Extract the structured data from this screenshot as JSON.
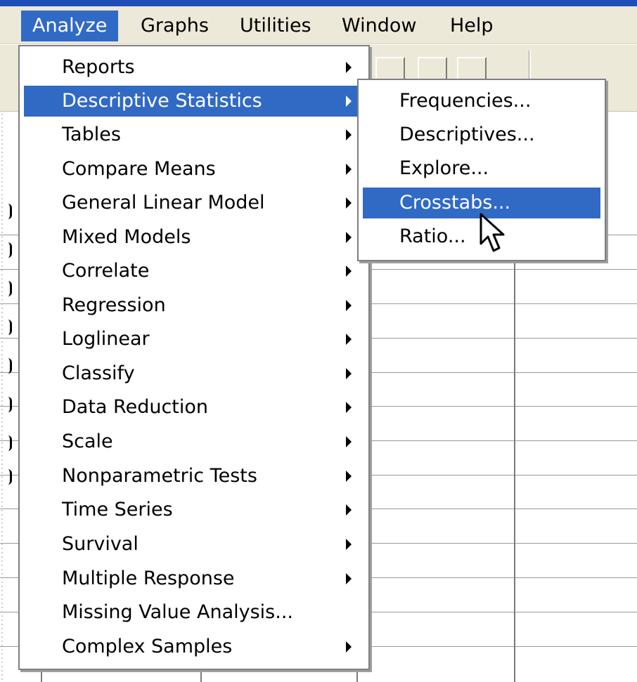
{
  "menubar": {
    "items": [
      "Analyze",
      "Graphs",
      "Utilities",
      "Window",
      "Help"
    ],
    "active": "Analyze"
  },
  "analyze_menu": {
    "items": [
      {
        "label": "Reports",
        "submenu": true
      },
      {
        "label": "Descriptive Statistics",
        "submenu": true,
        "highlighted": true
      },
      {
        "label": "Tables",
        "submenu": true
      },
      {
        "label": "Compare Means",
        "submenu": true
      },
      {
        "label": "General Linear Model",
        "submenu": true
      },
      {
        "label": "Mixed Models",
        "submenu": true
      },
      {
        "label": "Correlate",
        "submenu": true
      },
      {
        "label": "Regression",
        "submenu": true
      },
      {
        "label": "Loglinear",
        "submenu": true
      },
      {
        "label": "Classify",
        "submenu": true
      },
      {
        "label": "Data Reduction",
        "submenu": true
      },
      {
        "label": "Scale",
        "submenu": true
      },
      {
        "label": "Nonparametric Tests",
        "submenu": true
      },
      {
        "label": "Time Series",
        "submenu": true
      },
      {
        "label": "Survival",
        "submenu": true
      },
      {
        "label": "Multiple Response",
        "submenu": true
      },
      {
        "label": "Missing Value Analysis...",
        "submenu": false
      },
      {
        "label": "Complex Samples",
        "submenu": true
      }
    ]
  },
  "descriptive_submenu": {
    "items": [
      {
        "label": "Frequencies...",
        "highlighted": false
      },
      {
        "label": "Descriptives...",
        "highlighted": false
      },
      {
        "label": "Explore...",
        "highlighted": false
      },
      {
        "label": "Crosstabs...",
        "highlighted": true
      },
      {
        "label": "Ratio...",
        "highlighted": false
      }
    ]
  },
  "colors": {
    "highlight": "#316ac5",
    "menubar_bg": "#ece9d8",
    "titlebar": "#1f4fb8"
  },
  "icons": {
    "cursor": "arrow-pointer-icon",
    "submenu_arrow": "triangle-right-icon"
  }
}
